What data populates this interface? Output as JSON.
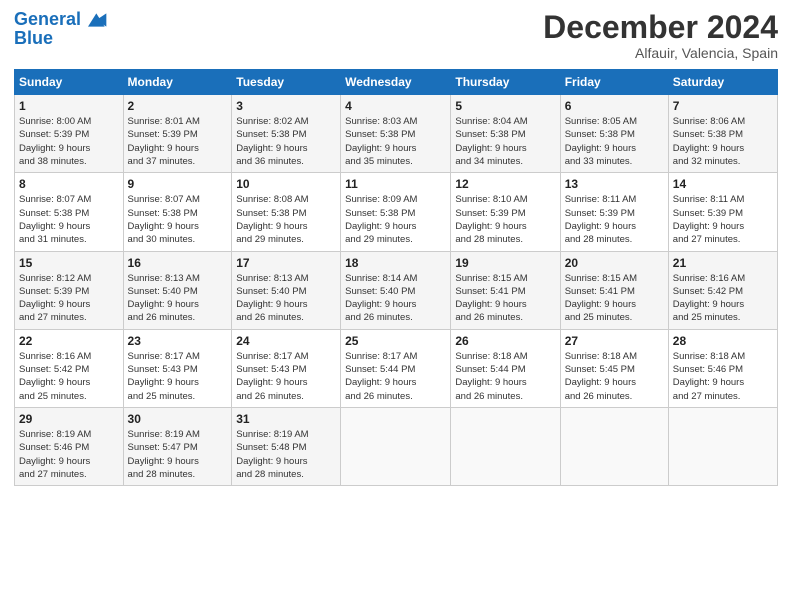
{
  "header": {
    "logo_line1": "General",
    "logo_line2": "Blue",
    "month_title": "December 2024",
    "subtitle": "Alfauir, Valencia, Spain"
  },
  "weekdays": [
    "Sunday",
    "Monday",
    "Tuesday",
    "Wednesday",
    "Thursday",
    "Friday",
    "Saturday"
  ],
  "weeks": [
    [
      {
        "day": "1",
        "info": "Sunrise: 8:00 AM\nSunset: 5:39 PM\nDaylight: 9 hours\nand 38 minutes."
      },
      {
        "day": "2",
        "info": "Sunrise: 8:01 AM\nSunset: 5:39 PM\nDaylight: 9 hours\nand 37 minutes."
      },
      {
        "day": "3",
        "info": "Sunrise: 8:02 AM\nSunset: 5:38 PM\nDaylight: 9 hours\nand 36 minutes."
      },
      {
        "day": "4",
        "info": "Sunrise: 8:03 AM\nSunset: 5:38 PM\nDaylight: 9 hours\nand 35 minutes."
      },
      {
        "day": "5",
        "info": "Sunrise: 8:04 AM\nSunset: 5:38 PM\nDaylight: 9 hours\nand 34 minutes."
      },
      {
        "day": "6",
        "info": "Sunrise: 8:05 AM\nSunset: 5:38 PM\nDaylight: 9 hours\nand 33 minutes."
      },
      {
        "day": "7",
        "info": "Sunrise: 8:06 AM\nSunset: 5:38 PM\nDaylight: 9 hours\nand 32 minutes."
      }
    ],
    [
      {
        "day": "8",
        "info": "Sunrise: 8:07 AM\nSunset: 5:38 PM\nDaylight: 9 hours\nand 31 minutes."
      },
      {
        "day": "9",
        "info": "Sunrise: 8:07 AM\nSunset: 5:38 PM\nDaylight: 9 hours\nand 30 minutes."
      },
      {
        "day": "10",
        "info": "Sunrise: 8:08 AM\nSunset: 5:38 PM\nDaylight: 9 hours\nand 29 minutes."
      },
      {
        "day": "11",
        "info": "Sunrise: 8:09 AM\nSunset: 5:38 PM\nDaylight: 9 hours\nand 29 minutes."
      },
      {
        "day": "12",
        "info": "Sunrise: 8:10 AM\nSunset: 5:39 PM\nDaylight: 9 hours\nand 28 minutes."
      },
      {
        "day": "13",
        "info": "Sunrise: 8:11 AM\nSunset: 5:39 PM\nDaylight: 9 hours\nand 28 minutes."
      },
      {
        "day": "14",
        "info": "Sunrise: 8:11 AM\nSunset: 5:39 PM\nDaylight: 9 hours\nand 27 minutes."
      }
    ],
    [
      {
        "day": "15",
        "info": "Sunrise: 8:12 AM\nSunset: 5:39 PM\nDaylight: 9 hours\nand 27 minutes."
      },
      {
        "day": "16",
        "info": "Sunrise: 8:13 AM\nSunset: 5:40 PM\nDaylight: 9 hours\nand 26 minutes."
      },
      {
        "day": "17",
        "info": "Sunrise: 8:13 AM\nSunset: 5:40 PM\nDaylight: 9 hours\nand 26 minutes."
      },
      {
        "day": "18",
        "info": "Sunrise: 8:14 AM\nSunset: 5:40 PM\nDaylight: 9 hours\nand 26 minutes."
      },
      {
        "day": "19",
        "info": "Sunrise: 8:15 AM\nSunset: 5:41 PM\nDaylight: 9 hours\nand 26 minutes."
      },
      {
        "day": "20",
        "info": "Sunrise: 8:15 AM\nSunset: 5:41 PM\nDaylight: 9 hours\nand 25 minutes."
      },
      {
        "day": "21",
        "info": "Sunrise: 8:16 AM\nSunset: 5:42 PM\nDaylight: 9 hours\nand 25 minutes."
      }
    ],
    [
      {
        "day": "22",
        "info": "Sunrise: 8:16 AM\nSunset: 5:42 PM\nDaylight: 9 hours\nand 25 minutes."
      },
      {
        "day": "23",
        "info": "Sunrise: 8:17 AM\nSunset: 5:43 PM\nDaylight: 9 hours\nand 25 minutes."
      },
      {
        "day": "24",
        "info": "Sunrise: 8:17 AM\nSunset: 5:43 PM\nDaylight: 9 hours\nand 26 minutes."
      },
      {
        "day": "25",
        "info": "Sunrise: 8:17 AM\nSunset: 5:44 PM\nDaylight: 9 hours\nand 26 minutes."
      },
      {
        "day": "26",
        "info": "Sunrise: 8:18 AM\nSunset: 5:44 PM\nDaylight: 9 hours\nand 26 minutes."
      },
      {
        "day": "27",
        "info": "Sunrise: 8:18 AM\nSunset: 5:45 PM\nDaylight: 9 hours\nand 26 minutes."
      },
      {
        "day": "28",
        "info": "Sunrise: 8:18 AM\nSunset: 5:46 PM\nDaylight: 9 hours\nand 27 minutes."
      }
    ],
    [
      {
        "day": "29",
        "info": "Sunrise: 8:19 AM\nSunset: 5:46 PM\nDaylight: 9 hours\nand 27 minutes."
      },
      {
        "day": "30",
        "info": "Sunrise: 8:19 AM\nSunset: 5:47 PM\nDaylight: 9 hours\nand 28 minutes."
      },
      {
        "day": "31",
        "info": "Sunrise: 8:19 AM\nSunset: 5:48 PM\nDaylight: 9 hours\nand 28 minutes."
      },
      null,
      null,
      null,
      null
    ]
  ]
}
